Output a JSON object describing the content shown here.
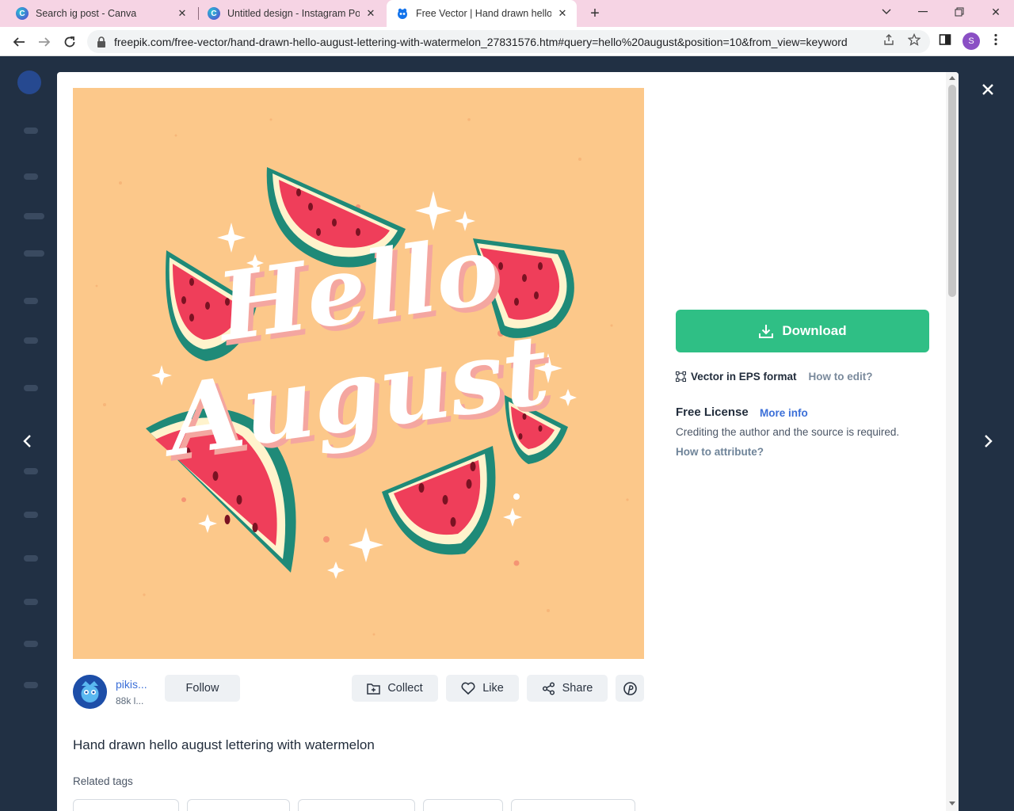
{
  "browser": {
    "tabs": [
      {
        "title": "Search ig post - Canva",
        "icon": "canva-icon"
      },
      {
        "title": "Untitled design - Instagram Post",
        "icon": "canva-icon"
      },
      {
        "title": "Free Vector | Hand drawn hello a",
        "icon": "freepik-icon"
      }
    ],
    "url": "freepik.com/free-vector/hand-drawn-hello-august-lettering-with-watermelon_27831576.htm#query=hello%20august&position=10&from_view=keyword",
    "profile_initial": "S"
  },
  "modal": {
    "artwork": {
      "line1": "Hello",
      "line2": "August"
    },
    "author": {
      "name": "pikis...",
      "followers": "88k l..."
    },
    "buttons": {
      "follow": "Follow",
      "collect": "Collect",
      "like": "Like",
      "share": "Share"
    },
    "title": "Hand drawn hello august lettering with watermelon",
    "related_tags_label": "Related tags",
    "download_label": "Download",
    "format_label": "Vector in EPS format",
    "how_to_edit": "How to edit?",
    "license_title": "Free License",
    "more_info": "More info",
    "credit_text": "Crediting the author and the source is required.",
    "how_to_attribute": "How to attribute?"
  },
  "colors": {
    "accent_green": "#2fbf85",
    "link_blue": "#3b6fd8",
    "artwork_background": "#fcc88a",
    "watermelon_red": "#ef3e5a",
    "rind_green": "#1f8a78"
  }
}
